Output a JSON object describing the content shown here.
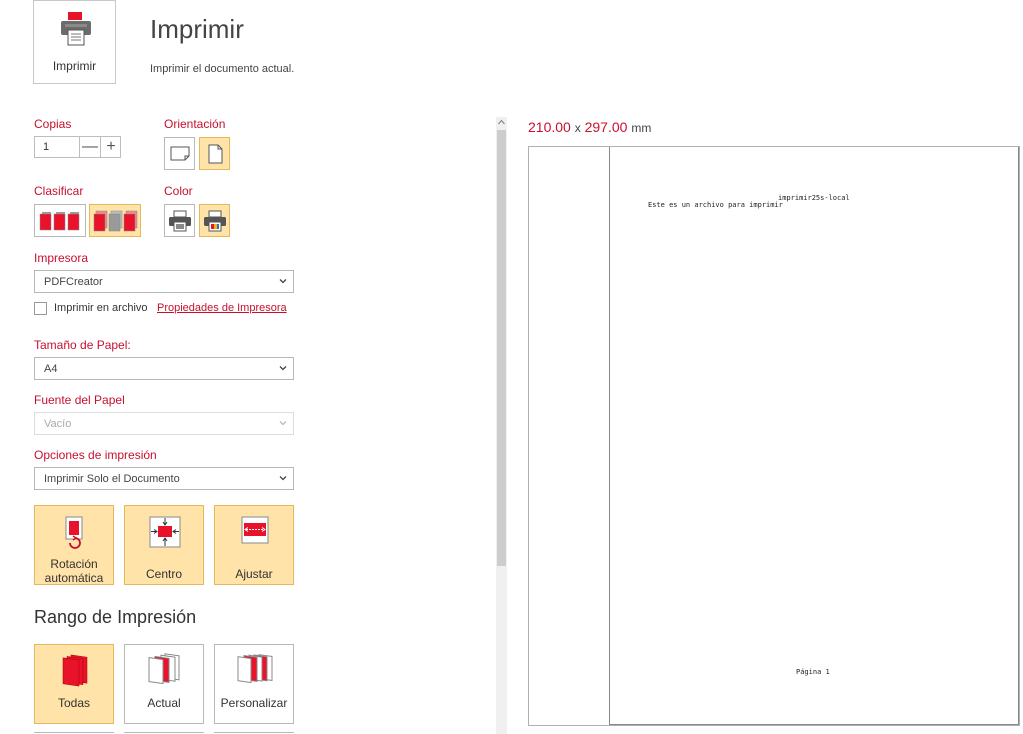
{
  "header": {
    "print_button_label": "Imprimir",
    "title": "Imprimir",
    "subtitle": "Imprimir el documento actual."
  },
  "copies": {
    "label": "Copias",
    "value": "1",
    "minus": "—",
    "plus": "+"
  },
  "orientation": {
    "label": "Orientación",
    "options": [
      "landscape-icon",
      "portrait-icon"
    ],
    "selected": "portrait"
  },
  "collate": {
    "label": "Clasificar",
    "options": [
      "collated-icon",
      "uncollated-icon"
    ],
    "selected": "uncollated"
  },
  "color": {
    "label": "Color",
    "options": [
      "grayscale-printer-icon",
      "color-printer-icon"
    ],
    "selected": "color"
  },
  "printer": {
    "label": "Impresora",
    "value": "PDFCreator",
    "print_to_file_label": "Imprimir en archivo",
    "properties_link": "Propiedades de Impresora"
  },
  "paper_size": {
    "label": "Tamaño de Papel:",
    "value": "A4"
  },
  "paper_source": {
    "label": "Fuente del Papel",
    "value": "Vacío"
  },
  "print_options": {
    "label": "Opciones de impresión",
    "value": "Imprimir Solo el Documento"
  },
  "fit": {
    "auto_rotate_line1": "Rotación",
    "auto_rotate_line2": "automática",
    "center": "Centro",
    "fit": "Ajustar"
  },
  "range": {
    "title": "Rango de Impresión",
    "all": "Todas",
    "current": "Actual",
    "custom": "Personalizar"
  },
  "preview": {
    "width": "210.00",
    "x": "x",
    "height": "297.00",
    "unit": "mm",
    "header_text": "imprimir25s-local",
    "body_text": "Este es un archivo para imprimir",
    "footer_text": "Página 1"
  },
  "colors": {
    "accent": "#c8102e",
    "selected_bg": "#ffe3a8",
    "selected_border": "#e4b95c"
  }
}
